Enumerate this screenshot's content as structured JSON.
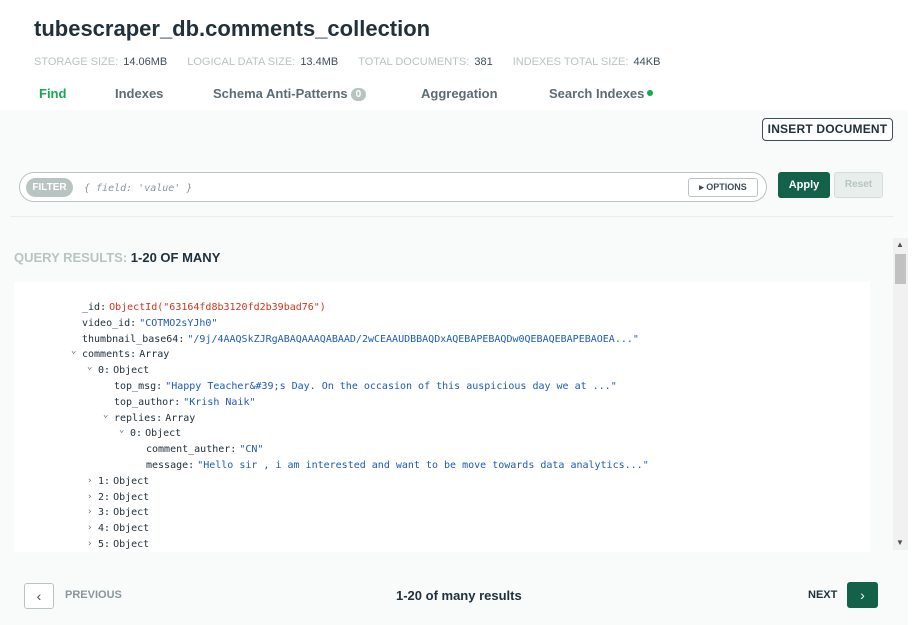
{
  "header": {
    "title": "tubescraper_db.comments_collection",
    "stats": [
      {
        "label": "STORAGE SIZE:",
        "value": "14.06MB"
      },
      {
        "label": "LOGICAL DATA SIZE:",
        "value": "13.4MB"
      },
      {
        "label": "TOTAL DOCUMENTS:",
        "value": "381"
      },
      {
        "label": "INDEXES TOTAL SIZE:",
        "value": "44KB"
      }
    ],
    "tabs": [
      {
        "label": "Find",
        "active": true
      },
      {
        "label": "Indexes"
      },
      {
        "label": "Schema Anti-Patterns",
        "badge": "0"
      },
      {
        "label": "Aggregation"
      },
      {
        "label": "Search Indexes",
        "status_dot": "green"
      }
    ]
  },
  "toolbar": {
    "insert_label": "INSERT DOCUMENT",
    "filter_label": "FILTER",
    "filter_placeholder": "{ field: 'value' }",
    "options_label": "OPTIONS",
    "apply_label": "Apply",
    "reset_label": "Reset"
  },
  "results": {
    "label": "QUERY RESULTS:",
    "range": "1-20 OF MANY"
  },
  "document": {
    "lines": [
      {
        "indent": 0,
        "caret": "",
        "key": "_id",
        "type": "",
        "value": "ObjectId(\"63164fd8b3120fd2b39bad76\")",
        "vclass": "oid"
      },
      {
        "indent": 0,
        "caret": "",
        "key": "video_id",
        "type": "",
        "value": "\"COTMO2sYJh0\"",
        "vclass": "s"
      },
      {
        "indent": 0,
        "caret": "",
        "key": "thumbnail_base64",
        "type": "",
        "value": "\"/9j/4AAQSkZJRgABAQAAAQABAAD/2wCEAAUDBBAQDxAQEBAPEBAQDw0QEBAQEBAPEBAOEA...\"",
        "vclass": "s"
      },
      {
        "indent": 0,
        "caret": "down",
        "key": "comments",
        "type": "Array",
        "value": "",
        "vclass": ""
      },
      {
        "indent": 1,
        "caret": "down",
        "key": "0",
        "type": "Object",
        "value": "",
        "vclass": ""
      },
      {
        "indent": 2,
        "caret": "",
        "key": "top_msg",
        "type": "",
        "value": "\"Happy Teacher&#39;s Day. On the occasion of this auspicious day we at ...\"",
        "vclass": "s"
      },
      {
        "indent": 2,
        "caret": "",
        "key": "top_author",
        "type": "",
        "value": "\"Krish Naik\"",
        "vclass": "s"
      },
      {
        "indent": 2,
        "caret": "down",
        "key": "replies",
        "type": "Array",
        "value": "",
        "vclass": ""
      },
      {
        "indent": 3,
        "caret": "down",
        "key": "0",
        "type": "Object",
        "value": "",
        "vclass": ""
      },
      {
        "indent": 4,
        "caret": "",
        "key": "comment_auther",
        "type": "",
        "value": "\"CN\"",
        "vclass": "s"
      },
      {
        "indent": 4,
        "caret": "",
        "key": "message",
        "type": "",
        "value": "\"Hello sir , i am interested and want to be move towards data analytics...\"",
        "vclass": "s"
      },
      {
        "indent": 1,
        "caret": "right",
        "key": "1",
        "type": "Object",
        "value": "",
        "vclass": ""
      },
      {
        "indent": 1,
        "caret": "right",
        "key": "2",
        "type": "Object",
        "value": "",
        "vclass": ""
      },
      {
        "indent": 1,
        "caret": "right",
        "key": "3",
        "type": "Object",
        "value": "",
        "vclass": ""
      },
      {
        "indent": 1,
        "caret": "right",
        "key": "4",
        "type": "Object",
        "value": "",
        "vclass": ""
      },
      {
        "indent": 1,
        "caret": "right",
        "key": "5",
        "type": "Object",
        "value": "",
        "vclass": ""
      }
    ]
  },
  "pagination": {
    "previous_label": "PREVIOUS",
    "info": "1-20 of many results",
    "next_label": "NEXT"
  },
  "colors": {
    "accent_green": "#13aa52",
    "button_dark_green": "#136149",
    "string_blue": "#1d5bb5",
    "objectid_red": "#d0331c"
  }
}
